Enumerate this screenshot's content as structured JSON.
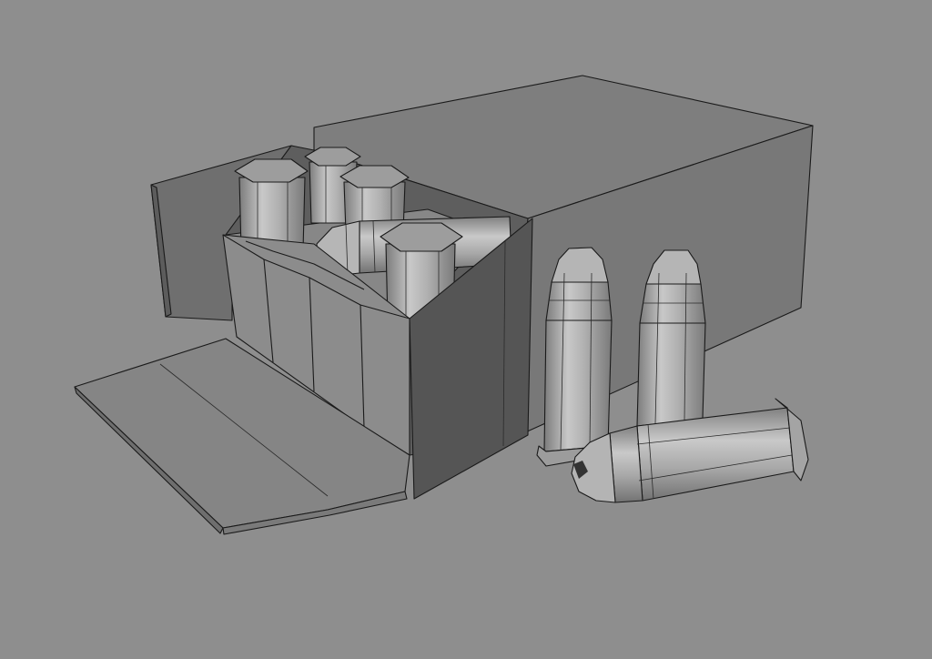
{
  "scene": {
    "background_color": "#8e8e8e",
    "objects": [
      {
        "name": "ammo-box",
        "color": "#8a8a8a"
      },
      {
        "name": "standing-bullet",
        "count": 2
      },
      {
        "name": "lying-bullet",
        "count": 1
      }
    ]
  }
}
